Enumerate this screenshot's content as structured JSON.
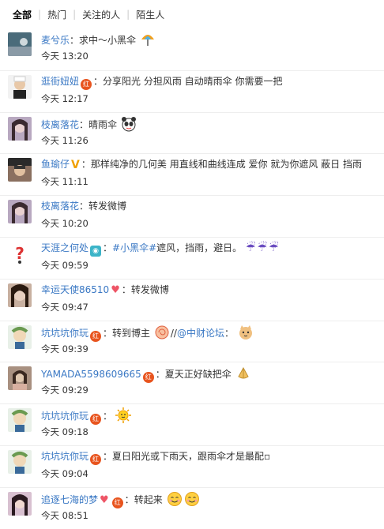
{
  "tabs": [
    {
      "label": "全部",
      "active": true
    },
    {
      "label": "热门",
      "active": false
    },
    {
      "label": "关注的人",
      "active": false
    },
    {
      "label": "陌生人",
      "active": false
    }
  ],
  "colors": {
    "name": "#3a78c4",
    "text": "#333333",
    "badge_red": "#e8541e",
    "divider": "#eeeeee"
  },
  "items": [
    {
      "name": "麦兮乐",
      "text": "求中～小黑伞",
      "time": "今天 13:20"
    },
    {
      "name": "逛街妞妞",
      "badge": "红",
      "text": "分享阳光 分担风雨  自动晴雨伞 你需要一把",
      "time": "今天 12:17"
    },
    {
      "name": "枝离落花",
      "text": "晴雨伞",
      "time": "今天 11:26"
    },
    {
      "name": "鱼瑜仔",
      "badge": "V",
      "text": "那样纯净的几何美  用直线和曲线连成  爱你 就为你遮风 蔽日 挡雨",
      "time": "今天 11:11"
    },
    {
      "name": "枝离落花",
      "text": "转发微博",
      "time": "今天 10:20"
    },
    {
      "name": "天涯之何处",
      "topic": "#小黑伞#",
      "text": "遮风，挡雨，避日。",
      "time": "今天 09:59"
    },
    {
      "name": "幸运天使86510",
      "text": "转发微博",
      "time": "今天 09:47"
    },
    {
      "name": "坑坑坑你玩",
      "badge": "红",
      "text": "转到博主",
      "mention": "@中财论坛",
      "time": "今天 09:39"
    },
    {
      "name": "YAMADA5598609665",
      "badge": "红",
      "text": "夏天正好缺把伞",
      "time": "今天 09:29"
    },
    {
      "name": "坑坑坑你玩",
      "badge": "红",
      "text": "",
      "time": "今天 09:18"
    },
    {
      "name": "坑坑坑你玩",
      "badge": "红",
      "text": "夏日阳光或下雨天，跟雨伞才是最配",
      "time": "今天 09:04"
    },
    {
      "name": "追逐七海的梦",
      "badge": "红",
      "text": "转起来",
      "time": "今天 08:51"
    }
  ],
  "icons": [
    "avatar",
    "umbrella-emoji",
    "panda-emoji",
    "sun-emoji",
    "cat-emoji",
    "prayer-emoji",
    "smile-emoji",
    "rainy-umbrella-emoji",
    "camera-badge",
    "heart-badge",
    "red-badge",
    "v-badge"
  ]
}
